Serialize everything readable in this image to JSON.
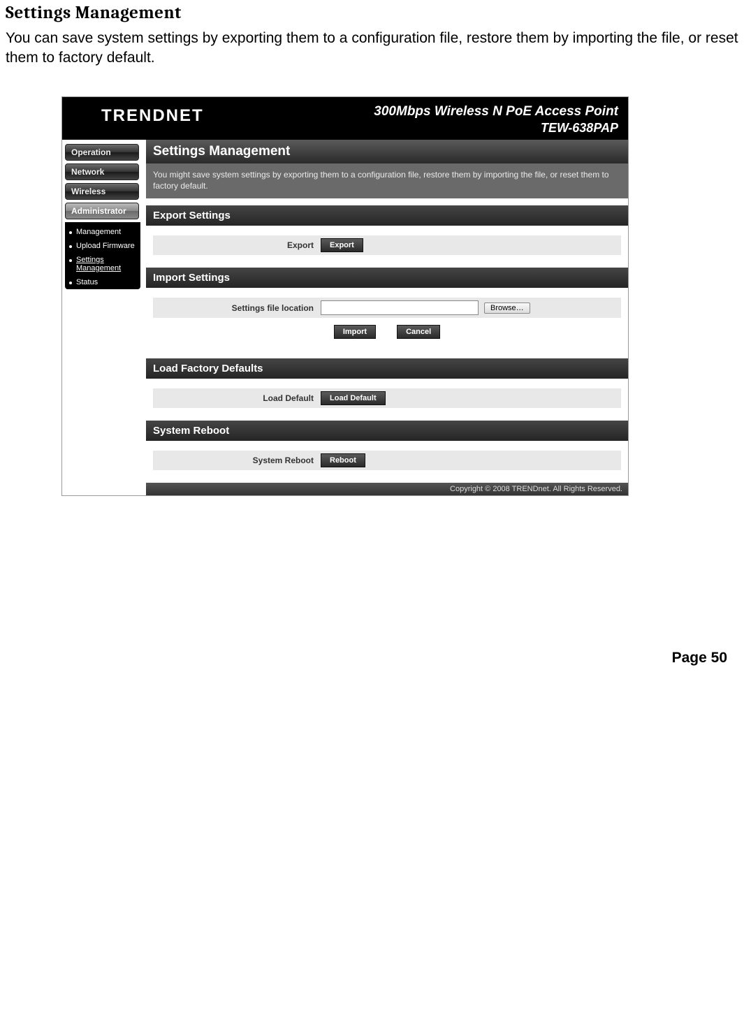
{
  "doc": {
    "title": "Settings Management",
    "description": "You can save system settings by exporting them to a configuration file, restore them by importing the file, or reset them to factory default.",
    "page_number": "Page  50"
  },
  "header": {
    "brand": "TRENDNET",
    "product_line1": "300Mbps Wireless N PoE Access Point",
    "product_line2": "TEW-638PAP"
  },
  "nav": {
    "items": [
      "Operation",
      "Network",
      "Wireless",
      "Administrator"
    ],
    "sub_items": [
      "Management",
      "Upload Firmware",
      "Settings Management",
      "Status"
    ]
  },
  "page": {
    "title": "Settings Management",
    "description": "You might save system settings by exporting them to a configuration file, restore them by importing the file, or reset them to factory default."
  },
  "sections": {
    "export": {
      "title": "Export Settings",
      "label": "Export",
      "button": "Export"
    },
    "import": {
      "title": "Import Settings",
      "label": "Settings file location",
      "browse": "Browse…",
      "import_btn": "Import",
      "cancel_btn": "Cancel"
    },
    "defaults": {
      "title": "Load Factory Defaults",
      "label": "Load Default",
      "button": "Load Default"
    },
    "reboot": {
      "title": "System Reboot",
      "label": "System Reboot",
      "button": "Reboot"
    }
  },
  "footer": {
    "text": "Copyright © 2008 TRENDnet. All Rights Reserved."
  }
}
